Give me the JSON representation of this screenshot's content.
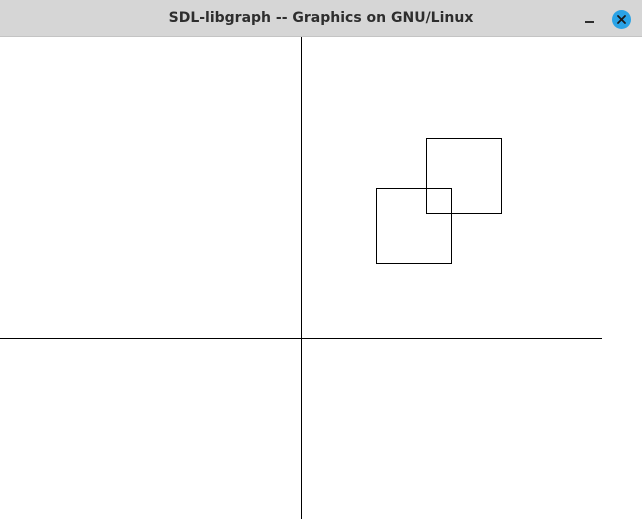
{
  "window": {
    "title": "SDL-libgraph -- Graphics on GNU/Linux"
  },
  "controls": {
    "minimize_icon": "minimize-icon",
    "close_icon": "close-icon",
    "close_color": "#2aa3e6"
  }
}
